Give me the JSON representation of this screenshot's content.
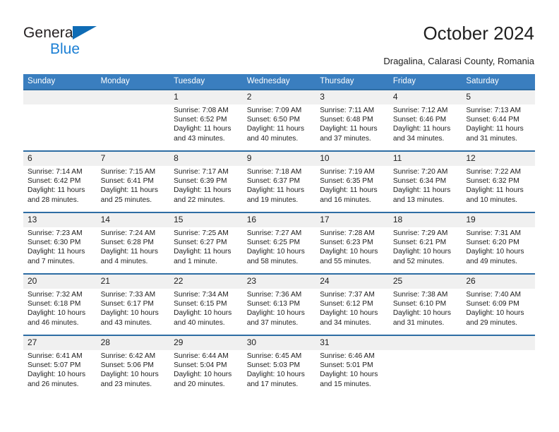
{
  "brand": {
    "line1": "General",
    "line2": "Blue",
    "triangle_color": "#0f6cb5",
    "line2_color": "#1b7fd4"
  },
  "header": {
    "title": "October 2024",
    "subtitle": "Dragalina, Calarasi County, Romania"
  },
  "colors": {
    "header_blue": "#3a7ebf",
    "week_rule_blue": "#2e6da4",
    "daynum_band": "#f0f0f0",
    "text": "#202020"
  },
  "weekday_headers": [
    "Sunday",
    "Monday",
    "Tuesday",
    "Wednesday",
    "Thursday",
    "Friday",
    "Saturday"
  ],
  "weeks": [
    [
      {
        "day": "",
        "empty": true
      },
      {
        "day": "",
        "empty": true
      },
      {
        "day": "1",
        "sunrise": "Sunrise: 7:08 AM",
        "sunset": "Sunset: 6:52 PM",
        "daylight1": "Daylight: 11 hours",
        "daylight2": "and 43 minutes."
      },
      {
        "day": "2",
        "sunrise": "Sunrise: 7:09 AM",
        "sunset": "Sunset: 6:50 PM",
        "daylight1": "Daylight: 11 hours",
        "daylight2": "and 40 minutes."
      },
      {
        "day": "3",
        "sunrise": "Sunrise: 7:11 AM",
        "sunset": "Sunset: 6:48 PM",
        "daylight1": "Daylight: 11 hours",
        "daylight2": "and 37 minutes."
      },
      {
        "day": "4",
        "sunrise": "Sunrise: 7:12 AM",
        "sunset": "Sunset: 6:46 PM",
        "daylight1": "Daylight: 11 hours",
        "daylight2": "and 34 minutes."
      },
      {
        "day": "5",
        "sunrise": "Sunrise: 7:13 AM",
        "sunset": "Sunset: 6:44 PM",
        "daylight1": "Daylight: 11 hours",
        "daylight2": "and 31 minutes."
      }
    ],
    [
      {
        "day": "6",
        "sunrise": "Sunrise: 7:14 AM",
        "sunset": "Sunset: 6:42 PM",
        "daylight1": "Daylight: 11 hours",
        "daylight2": "and 28 minutes."
      },
      {
        "day": "7",
        "sunrise": "Sunrise: 7:15 AM",
        "sunset": "Sunset: 6:41 PM",
        "daylight1": "Daylight: 11 hours",
        "daylight2": "and 25 minutes."
      },
      {
        "day": "8",
        "sunrise": "Sunrise: 7:17 AM",
        "sunset": "Sunset: 6:39 PM",
        "daylight1": "Daylight: 11 hours",
        "daylight2": "and 22 minutes."
      },
      {
        "day": "9",
        "sunrise": "Sunrise: 7:18 AM",
        "sunset": "Sunset: 6:37 PM",
        "daylight1": "Daylight: 11 hours",
        "daylight2": "and 19 minutes."
      },
      {
        "day": "10",
        "sunrise": "Sunrise: 7:19 AM",
        "sunset": "Sunset: 6:35 PM",
        "daylight1": "Daylight: 11 hours",
        "daylight2": "and 16 minutes."
      },
      {
        "day": "11",
        "sunrise": "Sunrise: 7:20 AM",
        "sunset": "Sunset: 6:34 PM",
        "daylight1": "Daylight: 11 hours",
        "daylight2": "and 13 minutes."
      },
      {
        "day": "12",
        "sunrise": "Sunrise: 7:22 AM",
        "sunset": "Sunset: 6:32 PM",
        "daylight1": "Daylight: 11 hours",
        "daylight2": "and 10 minutes."
      }
    ],
    [
      {
        "day": "13",
        "sunrise": "Sunrise: 7:23 AM",
        "sunset": "Sunset: 6:30 PM",
        "daylight1": "Daylight: 11 hours",
        "daylight2": "and 7 minutes."
      },
      {
        "day": "14",
        "sunrise": "Sunrise: 7:24 AM",
        "sunset": "Sunset: 6:28 PM",
        "daylight1": "Daylight: 11 hours",
        "daylight2": "and 4 minutes."
      },
      {
        "day": "15",
        "sunrise": "Sunrise: 7:25 AM",
        "sunset": "Sunset: 6:27 PM",
        "daylight1": "Daylight: 11 hours",
        "daylight2": "and 1 minute."
      },
      {
        "day": "16",
        "sunrise": "Sunrise: 7:27 AM",
        "sunset": "Sunset: 6:25 PM",
        "daylight1": "Daylight: 10 hours",
        "daylight2": "and 58 minutes."
      },
      {
        "day": "17",
        "sunrise": "Sunrise: 7:28 AM",
        "sunset": "Sunset: 6:23 PM",
        "daylight1": "Daylight: 10 hours",
        "daylight2": "and 55 minutes."
      },
      {
        "day": "18",
        "sunrise": "Sunrise: 7:29 AM",
        "sunset": "Sunset: 6:21 PM",
        "daylight1": "Daylight: 10 hours",
        "daylight2": "and 52 minutes."
      },
      {
        "day": "19",
        "sunrise": "Sunrise: 7:31 AM",
        "sunset": "Sunset: 6:20 PM",
        "daylight1": "Daylight: 10 hours",
        "daylight2": "and 49 minutes."
      }
    ],
    [
      {
        "day": "20",
        "sunrise": "Sunrise: 7:32 AM",
        "sunset": "Sunset: 6:18 PM",
        "daylight1": "Daylight: 10 hours",
        "daylight2": "and 46 minutes."
      },
      {
        "day": "21",
        "sunrise": "Sunrise: 7:33 AM",
        "sunset": "Sunset: 6:17 PM",
        "daylight1": "Daylight: 10 hours",
        "daylight2": "and 43 minutes."
      },
      {
        "day": "22",
        "sunrise": "Sunrise: 7:34 AM",
        "sunset": "Sunset: 6:15 PM",
        "daylight1": "Daylight: 10 hours",
        "daylight2": "and 40 minutes."
      },
      {
        "day": "23",
        "sunrise": "Sunrise: 7:36 AM",
        "sunset": "Sunset: 6:13 PM",
        "daylight1": "Daylight: 10 hours",
        "daylight2": "and 37 minutes."
      },
      {
        "day": "24",
        "sunrise": "Sunrise: 7:37 AM",
        "sunset": "Sunset: 6:12 PM",
        "daylight1": "Daylight: 10 hours",
        "daylight2": "and 34 minutes."
      },
      {
        "day": "25",
        "sunrise": "Sunrise: 7:38 AM",
        "sunset": "Sunset: 6:10 PM",
        "daylight1": "Daylight: 10 hours",
        "daylight2": "and 31 minutes."
      },
      {
        "day": "26",
        "sunrise": "Sunrise: 7:40 AM",
        "sunset": "Sunset: 6:09 PM",
        "daylight1": "Daylight: 10 hours",
        "daylight2": "and 29 minutes."
      }
    ],
    [
      {
        "day": "27",
        "sunrise": "Sunrise: 6:41 AM",
        "sunset": "Sunset: 5:07 PM",
        "daylight1": "Daylight: 10 hours",
        "daylight2": "and 26 minutes."
      },
      {
        "day": "28",
        "sunrise": "Sunrise: 6:42 AM",
        "sunset": "Sunset: 5:06 PM",
        "daylight1": "Daylight: 10 hours",
        "daylight2": "and 23 minutes."
      },
      {
        "day": "29",
        "sunrise": "Sunrise: 6:44 AM",
        "sunset": "Sunset: 5:04 PM",
        "daylight1": "Daylight: 10 hours",
        "daylight2": "and 20 minutes."
      },
      {
        "day": "30",
        "sunrise": "Sunrise: 6:45 AM",
        "sunset": "Sunset: 5:03 PM",
        "daylight1": "Daylight: 10 hours",
        "daylight2": "and 17 minutes."
      },
      {
        "day": "31",
        "sunrise": "Sunrise: 6:46 AM",
        "sunset": "Sunset: 5:01 PM",
        "daylight1": "Daylight: 10 hours",
        "daylight2": "and 15 minutes."
      },
      {
        "day": "",
        "empty": true
      },
      {
        "day": "",
        "empty": true
      }
    ]
  ]
}
